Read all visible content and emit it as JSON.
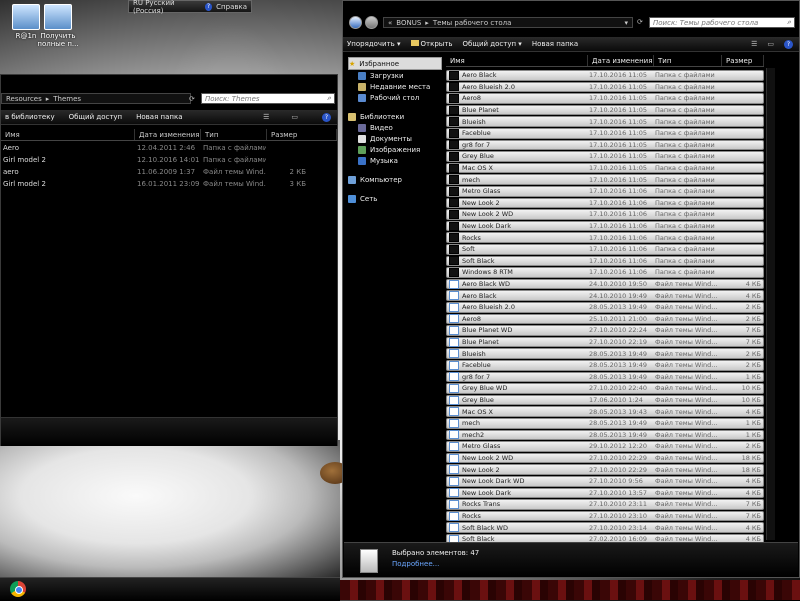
{
  "desktop": {
    "icons": [
      {
        "label": "R@1n"
      },
      {
        "label": "Получить полные п..."
      }
    ]
  },
  "langbar": {
    "lang": "RU Русский (Россия)",
    "help": "Справка"
  },
  "left_window": {
    "breadcrumb": [
      "Resources",
      "Themes"
    ],
    "search_placeholder": "Поиск: Themes",
    "toolbar": [
      "в библиотеку",
      "Общий доступ",
      "Новая папка"
    ],
    "columns": [
      "Имя",
      "Дата изменения",
      "Тип",
      "Размер"
    ],
    "rows": [
      {
        "name": "Aero",
        "date": "12.04.2011 2:46",
        "type": "Папка с файлами",
        "size": ""
      },
      {
        "name": "Girl model 2",
        "date": "12.10.2016 14:01",
        "type": "Папка с файлами",
        "size": ""
      },
      {
        "name": "aero",
        "date": "11.06.2009 1:37",
        "type": "Файл темы Wind...",
        "size": "2 КБ"
      },
      {
        "name": "Girl model 2",
        "date": "16.01.2011 23:09",
        "type": "Файл темы Wind...",
        "size": "3 КБ"
      }
    ]
  },
  "right_window": {
    "breadcrumb": [
      "BONUS",
      "Темы рабочего стола"
    ],
    "search_placeholder": "Поиск: Темы рабочего стола",
    "toolbar": [
      "Упорядочить",
      "Открыть",
      "Общий доступ",
      "Новая папка"
    ],
    "columns": [
      "Имя",
      "Дата изменения",
      "Тип",
      "Размер"
    ],
    "nav": {
      "favorites": "Избранное",
      "favorites_items": [
        "Загрузки",
        "Недавние места",
        "Рабочий стол"
      ],
      "libraries": "Библиотеки",
      "libraries_items": [
        "Видео",
        "Документы",
        "Изображения",
        "Музыка"
      ],
      "computer": "Компьютер",
      "network": "Сеть"
    },
    "rows": [
      {
        "name": "Aero Black",
        "date": "17.10.2016 11:05",
        "type": "Папка с файлами",
        "size": "",
        "kind": "folder"
      },
      {
        "name": "Aero Blueish 2.0",
        "date": "17.10.2016 11:05",
        "type": "Папка с файлами",
        "size": "",
        "kind": "folder"
      },
      {
        "name": "Aero8",
        "date": "17.10.2016 11:05",
        "type": "Папка с файлами",
        "size": "",
        "kind": "folder"
      },
      {
        "name": "Blue Planet",
        "date": "17.10.2016 11:05",
        "type": "Папка с файлами",
        "size": "",
        "kind": "folder"
      },
      {
        "name": "Blueish",
        "date": "17.10.2016 11:05",
        "type": "Папка с файлами",
        "size": "",
        "kind": "folder"
      },
      {
        "name": "Faceblue",
        "date": "17.10.2016 11:05",
        "type": "Папка с файлами",
        "size": "",
        "kind": "folder"
      },
      {
        "name": "gr8 for 7",
        "date": "17.10.2016 11:05",
        "type": "Папка с файлами",
        "size": "",
        "kind": "folder"
      },
      {
        "name": "Grey Blue",
        "date": "17.10.2016 11:05",
        "type": "Папка с файлами",
        "size": "",
        "kind": "folder"
      },
      {
        "name": "Mac OS X",
        "date": "17.10.2016 11:05",
        "type": "Папка с файлами",
        "size": "",
        "kind": "folder"
      },
      {
        "name": "mech",
        "date": "17.10.2016 11:05",
        "type": "Папка с файлами",
        "size": "",
        "kind": "folder"
      },
      {
        "name": "Metro Glass",
        "date": "17.10.2016 11:06",
        "type": "Папка с файлами",
        "size": "",
        "kind": "folder"
      },
      {
        "name": "New Look 2",
        "date": "17.10.2016 11:06",
        "type": "Папка с файлами",
        "size": "",
        "kind": "folder"
      },
      {
        "name": "New Look 2 WD",
        "date": "17.10.2016 11:06",
        "type": "Папка с файлами",
        "size": "",
        "kind": "folder"
      },
      {
        "name": "New Look Dark",
        "date": "17.10.2016 11:06",
        "type": "Папка с файлами",
        "size": "",
        "kind": "folder"
      },
      {
        "name": "Rocks",
        "date": "17.10.2016 11:06",
        "type": "Папка с файлами",
        "size": "",
        "kind": "folder"
      },
      {
        "name": "Soft",
        "date": "17.10.2016 11:06",
        "type": "Папка с файлами",
        "size": "",
        "kind": "folder"
      },
      {
        "name": "Soft Black",
        "date": "17.10.2016 11:06",
        "type": "Папка с файлами",
        "size": "",
        "kind": "folder"
      },
      {
        "name": "Windows 8 RTM",
        "date": "17.10.2016 11:06",
        "type": "Папка с файлами",
        "size": "",
        "kind": "folder"
      },
      {
        "name": "Aero Black WD",
        "date": "24.10.2010 19:50",
        "type": "Файл темы Wind...",
        "size": "4 КБ",
        "kind": "theme"
      },
      {
        "name": "Aero Black",
        "date": "24.10.2010 19:49",
        "type": "Файл темы Wind...",
        "size": "4 КБ",
        "kind": "theme"
      },
      {
        "name": "Aero Blueish 2.0",
        "date": "28.05.2013 19:49",
        "type": "Файл темы Wind...",
        "size": "2 КБ",
        "kind": "theme"
      },
      {
        "name": "Aero8",
        "date": "25.10.2011 21:00",
        "type": "Файл темы Wind...",
        "size": "2 КБ",
        "kind": "theme"
      },
      {
        "name": "Blue Planet WD",
        "date": "27.10.2010 22:24",
        "type": "Файл темы Wind...",
        "size": "7 КБ",
        "kind": "theme"
      },
      {
        "name": "Blue Planet",
        "date": "27.10.2010 22:19",
        "type": "Файл темы Wind...",
        "size": "7 КБ",
        "kind": "theme"
      },
      {
        "name": "Blueish",
        "date": "28.05.2013 19:49",
        "type": "Файл темы Wind...",
        "size": "2 КБ",
        "kind": "theme"
      },
      {
        "name": "Faceblue",
        "date": "28.05.2013 19:49",
        "type": "Файл темы Wind...",
        "size": "2 КБ",
        "kind": "theme"
      },
      {
        "name": "gr8 for 7",
        "date": "28.05.2013 19:49",
        "type": "Файл темы Wind...",
        "size": "1 КБ",
        "kind": "theme"
      },
      {
        "name": "Grey Blue WD",
        "date": "27.10.2010 22:40",
        "type": "Файл темы Wind...",
        "size": "10 КБ",
        "kind": "theme"
      },
      {
        "name": "Grey Blue",
        "date": "17.06.2010 1:24",
        "type": "Файл темы Wind...",
        "size": "10 КБ",
        "kind": "theme"
      },
      {
        "name": "Mac OS X",
        "date": "28.05.2013 19:43",
        "type": "Файл темы Wind...",
        "size": "4 КБ",
        "kind": "theme"
      },
      {
        "name": "mech",
        "date": "28.05.2013 19:49",
        "type": "Файл темы Wind...",
        "size": "1 КБ",
        "kind": "theme"
      },
      {
        "name": "mech2",
        "date": "28.05.2013 19:49",
        "type": "Файл темы Wind...",
        "size": "1 КБ",
        "kind": "theme"
      },
      {
        "name": "Metro Glass",
        "date": "29.10.2012 12:20",
        "type": "Файл темы Wind...",
        "size": "2 КБ",
        "kind": "theme"
      },
      {
        "name": "New Look 2 WD",
        "date": "27.10.2010 22:29",
        "type": "Файл темы Wind...",
        "size": "18 КБ",
        "kind": "theme"
      },
      {
        "name": "New Look 2",
        "date": "27.10.2010 22:29",
        "type": "Файл темы Wind...",
        "size": "18 КБ",
        "kind": "theme"
      },
      {
        "name": "New Look Dark WD",
        "date": "27.10.2010 9:56",
        "type": "Файл темы Wind...",
        "size": "4 КБ",
        "kind": "theme"
      },
      {
        "name": "New Look Dark",
        "date": "27.10.2010 13:57",
        "type": "Файл темы Wind...",
        "size": "4 КБ",
        "kind": "theme"
      },
      {
        "name": "Rocks Trans",
        "date": "27.10.2010 23:11",
        "type": "Файл темы Wind...",
        "size": "7 КБ",
        "kind": "theme"
      },
      {
        "name": "Rocks",
        "date": "27.10.2010 23:10",
        "type": "Файл темы Wind...",
        "size": "7 КБ",
        "kind": "theme"
      },
      {
        "name": "Soft Black WD",
        "date": "27.10.2010 23:14",
        "type": "Файл темы Wind...",
        "size": "4 КБ",
        "kind": "theme"
      },
      {
        "name": "Soft Black",
        "date": "27.02.2010 16:09",
        "type": "Файл темы Wind...",
        "size": "4 КБ",
        "kind": "theme"
      }
    ],
    "status": {
      "selected": "Выбрано элементов: 47",
      "details": "Подробнее..."
    }
  },
  "colors": {
    "accent_blue": "#2a6cd6",
    "highlight": "#dcdcdc"
  }
}
